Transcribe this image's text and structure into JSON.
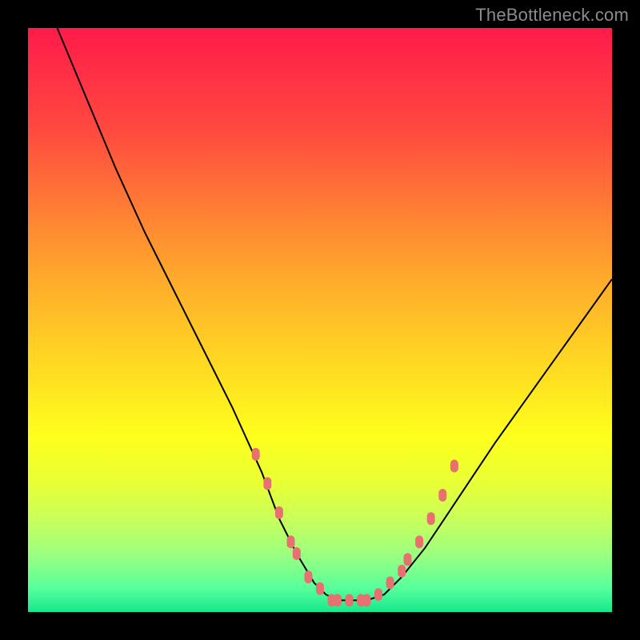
{
  "watermark": "TheBottleneck.com",
  "colors": {
    "page_bg": "#000000",
    "curve_stroke": "#000000",
    "marker_fill": "#e97070",
    "gradient_top": "#ff1b4a",
    "gradient_bottom": "#16e88d"
  },
  "chart_data": {
    "type": "line",
    "title": "",
    "xlabel": "",
    "ylabel": "",
    "xlim": [
      0,
      100
    ],
    "ylim": [
      0,
      100
    ],
    "grid": false,
    "legend": false,
    "series": [
      {
        "name": "curve",
        "x": [
          5,
          10,
          15,
          20,
          25,
          30,
          35,
          40,
          43,
          46,
          49,
          51,
          53,
          55,
          58,
          61,
          64,
          68,
          72,
          76,
          80,
          85,
          90,
          95,
          100
        ],
        "y": [
          100,
          88,
          76,
          65,
          55,
          45,
          35,
          24,
          16,
          10,
          5,
          3,
          2,
          2,
          2,
          3,
          6,
          11,
          17,
          23,
          29,
          36,
          43,
          50,
          57
        ]
      }
    ],
    "markers": {
      "name": "highlight-dots",
      "x": [
        39,
        41,
        43,
        45,
        46,
        48,
        50,
        52,
        53,
        55,
        57,
        58,
        60,
        62,
        64,
        65,
        67,
        69,
        71,
        73
      ],
      "y": [
        27,
        22,
        17,
        12,
        10,
        6,
        4,
        2,
        2,
        2,
        2,
        2,
        3,
        5,
        7,
        9,
        12,
        16,
        20,
        25
      ]
    }
  }
}
